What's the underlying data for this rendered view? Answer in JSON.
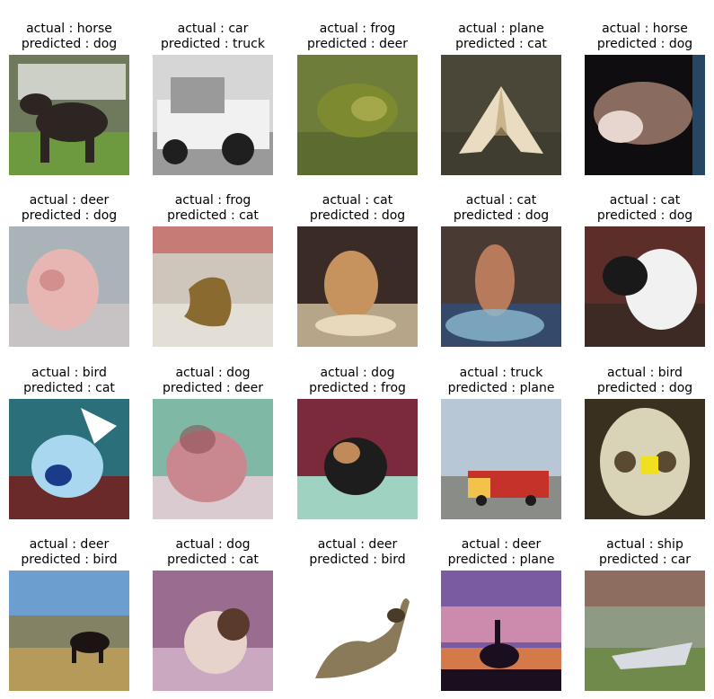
{
  "items": [
    {
      "actual": "actual : horse",
      "predicted": "predicted : dog",
      "subject": "horse",
      "palette": {
        "bg": "#6f7a5c",
        "ground": "#6e9a3f",
        "subject": "#2c2522",
        "accent": "#e5e6e1"
      }
    },
    {
      "actual": "actual : car",
      "predicted": "predicted : truck",
      "subject": "car",
      "palette": {
        "bg": "#d6d6d6",
        "ground": "#9a9a9a",
        "subject": "#f1f1f1",
        "accent": "#1f1f1f"
      }
    },
    {
      "actual": "actual : frog",
      "predicted": "predicted : deer",
      "subject": "frog",
      "palette": {
        "bg": "#6f7d3a",
        "ground": "#5c6c31",
        "subject": "#7e8a2f",
        "accent": "#a4a84a"
      }
    },
    {
      "actual": "actual : plane",
      "predicted": "predicted : cat",
      "subject": "plane",
      "palette": {
        "bg": "#4a4638",
        "ground": "#3f3c30",
        "subject": "#e9dcc0",
        "accent": "#b59a68"
      }
    },
    {
      "actual": "actual : horse",
      "predicted": "predicted : dog",
      "subject": "horse-head",
      "palette": {
        "bg": "#0f0d10",
        "ground": "#181418",
        "subject": "#8a6b5f",
        "accent": "#2f5f8a"
      }
    },
    {
      "actual": "actual : deer",
      "predicted": "predicted : dog",
      "subject": "animal",
      "palette": {
        "bg": "#aab4b8",
        "ground": "#c7c2c4",
        "subject": "#e7b6b3",
        "accent": "#d28f8e"
      }
    },
    {
      "actual": "actual : frog",
      "predicted": "predicted : cat",
      "subject": "frog-blob",
      "palette": {
        "bg": "#cfc6bb",
        "ground": "#e3ded6",
        "subject": "#8a6a2e",
        "accent": "#c24a4a"
      }
    },
    {
      "actual": "actual : cat",
      "predicted": "predicted : dog",
      "subject": "cat",
      "palette": {
        "bg": "#3a2b26",
        "ground": "#b7a58a",
        "subject": "#c6925d",
        "accent": "#e8d9bd"
      }
    },
    {
      "actual": "actual : cat",
      "predicted": "predicted : dog",
      "subject": "cat-sit",
      "palette": {
        "bg": "#4a3a34",
        "ground": "#354a6a",
        "subject": "#b77a5a",
        "accent": "#8bbad0"
      }
    },
    {
      "actual": "actual : cat",
      "predicted": "predicted : dog",
      "subject": "cat-bw",
      "palette": {
        "bg": "#5b2e2a",
        "ground": "#3d2a24",
        "subject": "#f1f1f1",
        "accent": "#191919"
      }
    },
    {
      "actual": "actual : bird",
      "predicted": "predicted : cat",
      "subject": "bird",
      "palette": {
        "bg": "#2b6f7a",
        "ground": "#6a2a2a",
        "subject": "#a8d7ef",
        "accent": "#1a3a8a"
      }
    },
    {
      "actual": "actual : dog",
      "predicted": "predicted : deer",
      "subject": "dog",
      "palette": {
        "bg": "#7fb9a6",
        "ground": "#d9cbd0",
        "subject": "#c98890",
        "accent": "#8c4f56"
      }
    },
    {
      "actual": "actual : dog",
      "predicted": "predicted : frog",
      "subject": "dog-dark",
      "palette": {
        "bg": "#7a2a3a",
        "ground": "#9fd2c0",
        "subject": "#1d1d1d",
        "accent": "#c08a5a"
      }
    },
    {
      "actual": "actual : truck",
      "predicted": "predicted : plane",
      "subject": "truck",
      "palette": {
        "bg": "#b7c7d6",
        "ground": "#8a8c88",
        "subject": "#c5322a",
        "accent": "#f2c24a"
      }
    },
    {
      "actual": "actual : bird",
      "predicted": "predicted : dog",
      "subject": "owl",
      "palette": {
        "bg": "#3a3020",
        "ground": "#2a2418",
        "subject": "#d9d3b8",
        "accent": "#f0e020"
      }
    },
    {
      "actual": "actual : deer",
      "predicted": "predicted : bird",
      "subject": "deer-field",
      "palette": {
        "bg": "#6c9fd0",
        "ground": "#b59a5a",
        "subject": "#1c1412",
        "accent": "#8a7a4a"
      }
    },
    {
      "actual": "actual : dog",
      "predicted": "predicted : cat",
      "subject": "dog-purple",
      "palette": {
        "bg": "#9a6d90",
        "ground": "#c9a8c0",
        "subject": "#e7d2cc",
        "accent": "#5a3a2c"
      }
    },
    {
      "actual": "actual : deer",
      "predicted": "predicted : bird",
      "subject": "deer-white",
      "palette": {
        "bg": "#ffffff",
        "ground": "#ffffff",
        "subject": "#8a7a5a",
        "accent": "#4a3a28"
      }
    },
    {
      "actual": "actual : deer",
      "predicted": "predicted : plane",
      "subject": "deer-sunset",
      "palette": {
        "bg": "#7a5aa0",
        "ground": "#d47a4a",
        "subject": "#1a0f1e",
        "accent": "#f0a0b0"
      }
    },
    {
      "actual": "actual : ship",
      "predicted": "predicted : car",
      "subject": "ship",
      "palette": {
        "bg": "#8e9a84",
        "ground": "#6f8a4a",
        "subject": "#d9dbe3",
        "accent": "#8a2a2a"
      }
    }
  ]
}
